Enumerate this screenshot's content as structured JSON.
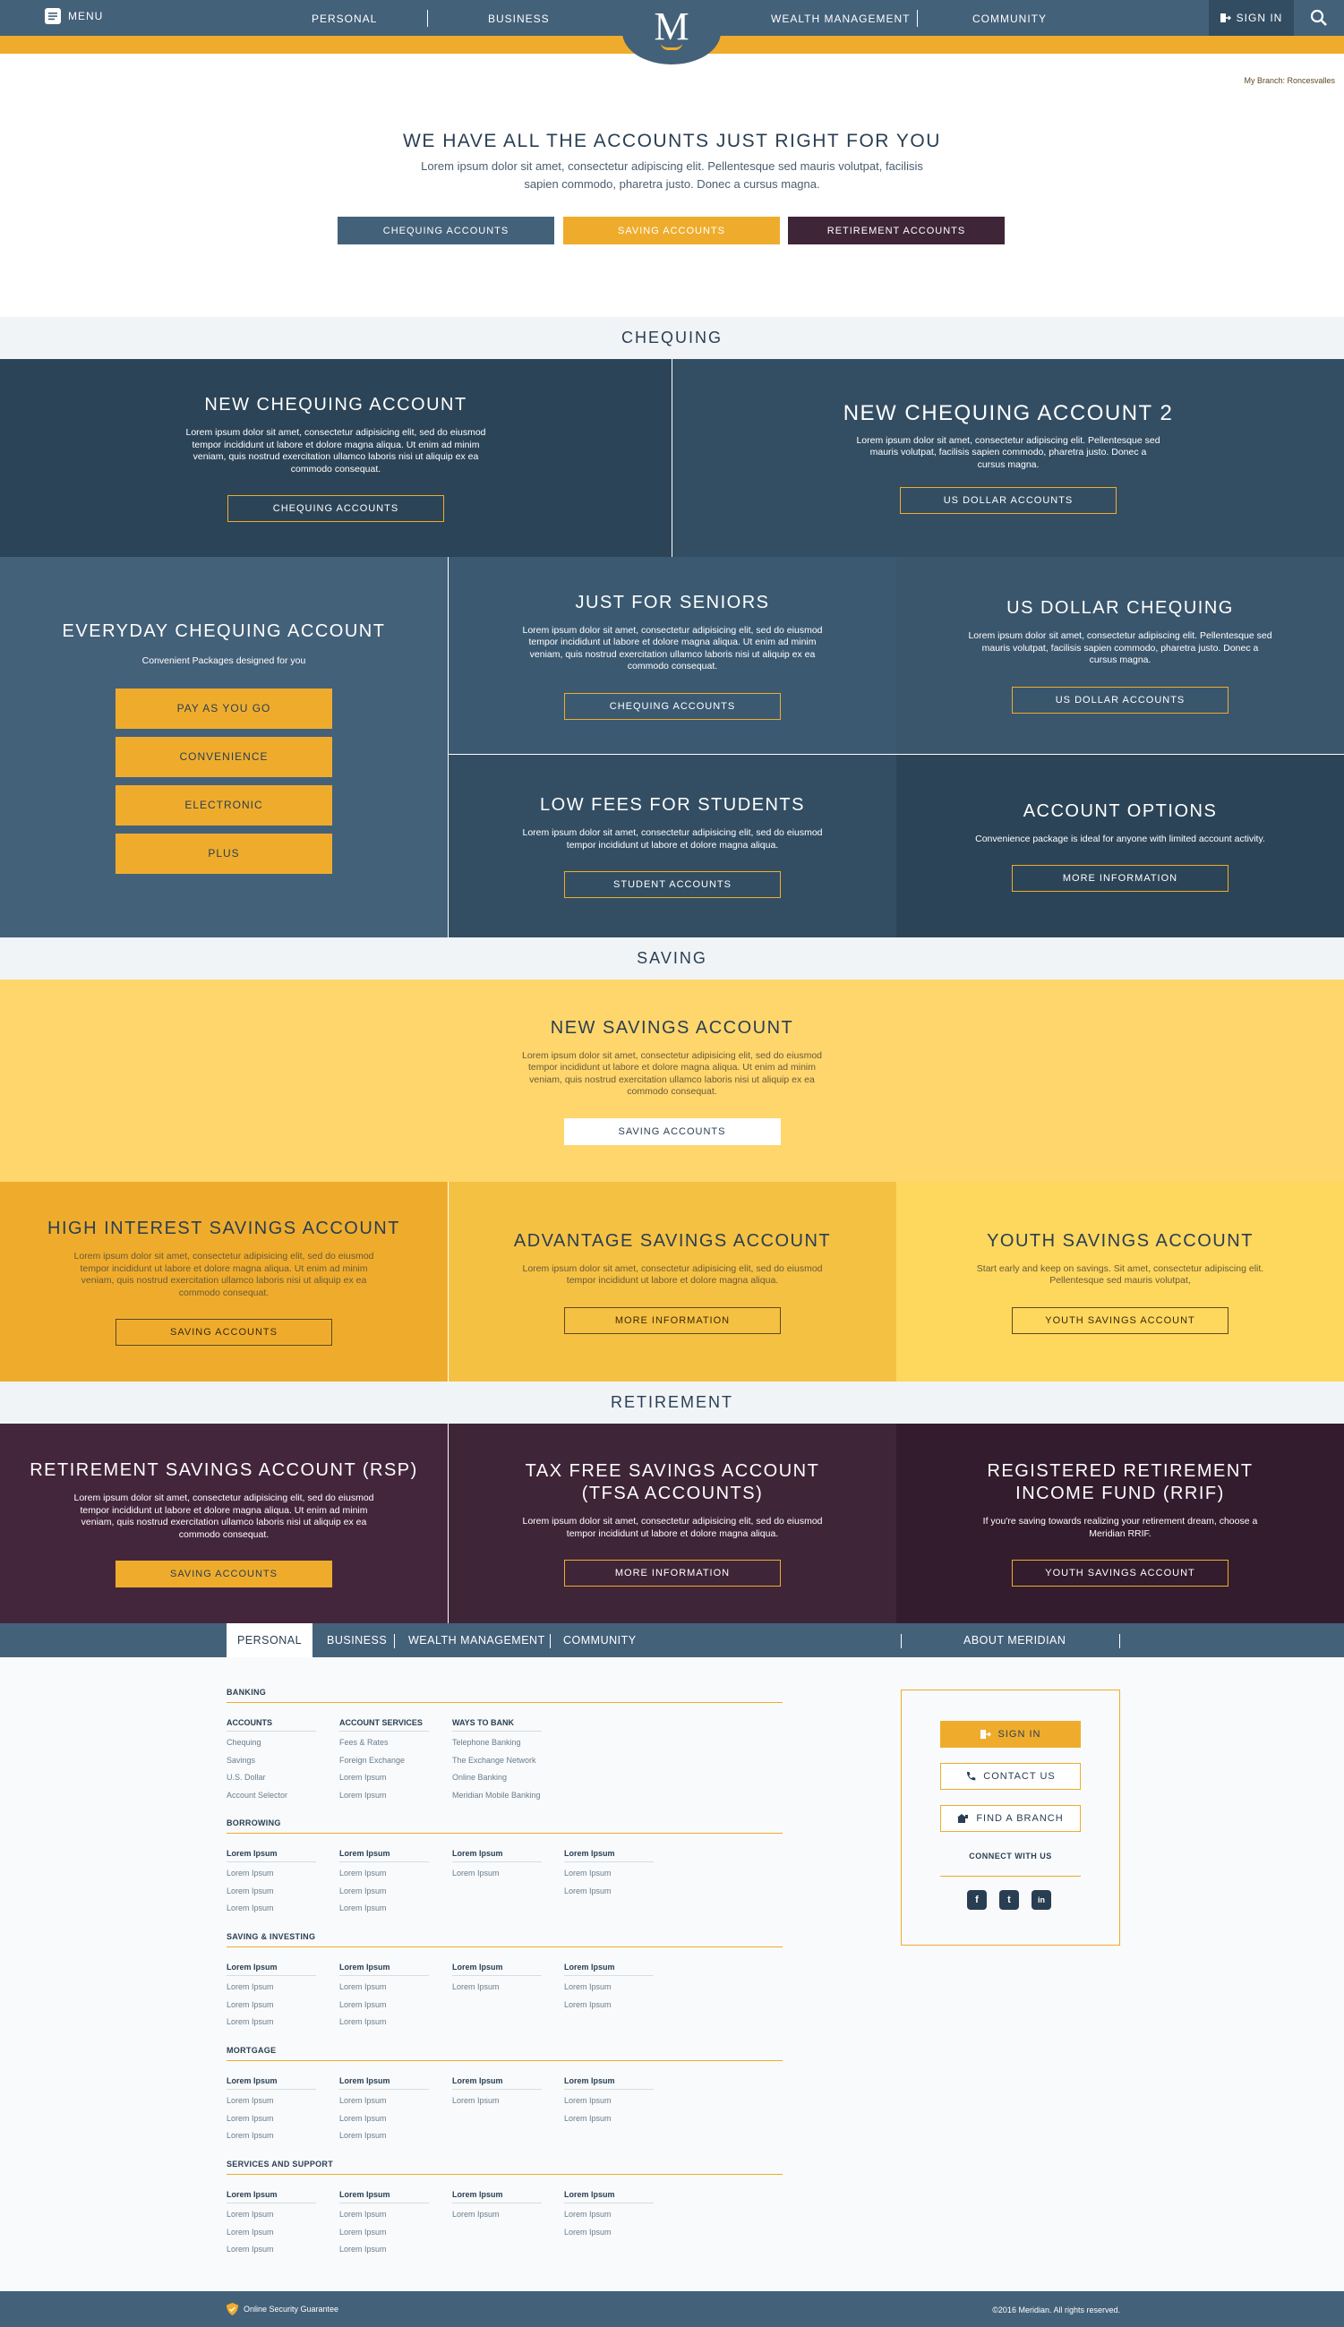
{
  "header": {
    "menu_label": "MENU",
    "nav": [
      "PERSONAL",
      "BUSINESS",
      "WEALTH MANAGEMENT",
      "COMMUNITY"
    ],
    "logo_letter": "M",
    "signin_label": "SIGN IN",
    "branch_text": "My Branch: Roncesvalles"
  },
  "hero": {
    "title": "WE HAVE ALL THE ACCOUNTS JUST RIGHT FOR YOU",
    "text": "Lorem ipsum dolor sit amet, consectetur adipiscing elit. Pellentesque sed mauris volutpat, facilisis sapien commodo, pharetra justo. Donec a cursus magna.",
    "buttons": [
      "CHEQUING ACCOUNTS",
      "SAVING ACCOUNTS",
      "RETIREMENT ACCOUNTS"
    ]
  },
  "sections": {
    "chequing": "CHEQUING",
    "saving": "SAVING",
    "retirement": "RETIREMENT"
  },
  "chequing": {
    "new": {
      "title": "NEW CHEQUING ACCOUNT",
      "text": "Lorem ipsum dolor sit amet, consectetur adipisicing elit, sed do eiusmod tempor incididunt ut labore et dolore magna aliqua. Ut enim ad minim veniam, quis nostrud exercitation ullamco laboris nisi ut aliquip ex ea commodo consequat.",
      "button": "CHEQUING ACCOUNTS"
    },
    "new2": {
      "title": "NEW CHEQUING ACCOUNT 2",
      "text": "Lorem ipsum dolor sit amet, consectetur adipiscing elit. Pellentesque sed mauris volutpat, facilisis sapien commodo, pharetra justo. Donec a cursus magna.",
      "button": "US DOLLAR ACCOUNTS"
    },
    "everyday": {
      "title": "EVERYDAY CHEQUING ACCOUNT",
      "subtitle": "Convenient Packages designed for you",
      "buttons": [
        "PAY AS YOU GO",
        "CONVENIENCE",
        "ELECTRONIC",
        "PLUS"
      ]
    },
    "seniors": {
      "title": "JUST FOR SENIORS",
      "text": "Lorem ipsum dolor sit amet, consectetur adipisicing elit, sed do eiusmod tempor incididunt ut labore et dolore magna aliqua. Ut enim ad minim veniam, quis nostrud exercitation ullamco laboris nisi ut aliquip ex ea commodo consequat.",
      "button": "CHEQUING ACCOUNTS"
    },
    "usd": {
      "title": "US DOLLAR CHEQUING",
      "text": "Lorem ipsum dolor sit amet, consectetur adipiscing elit. Pellentesque sed mauris volutpat, facilisis sapien commodo, pharetra justo. Donec a cursus magna.",
      "button": "US DOLLAR ACCOUNTS"
    },
    "students": {
      "title": "LOW FEES FOR STUDENTS",
      "text": "Lorem ipsum dolor sit amet, consectetur adipisicing elit, sed do eiusmod tempor incididunt ut labore et dolore magna aliqua.",
      "button": "STUDENT ACCOUNTS"
    },
    "options": {
      "title": "ACCOUNT OPTIONS",
      "text": "Convenience package is ideal for anyone with limited account activity.",
      "button": "MORE INFORMATION"
    }
  },
  "saving": {
    "new": {
      "title": "NEW SAVINGS ACCOUNT",
      "text": "Lorem ipsum dolor sit amet, consectetur adipisicing elit, sed do eiusmod tempor incididunt ut labore et dolore magna aliqua. Ut enim ad minim veniam, quis nostrud exercitation ullamco laboris nisi ut aliquip ex ea commodo consequat.",
      "button": "SAVING ACCOUNTS"
    },
    "high": {
      "title": "HIGH INTEREST SAVINGS ACCOUNT",
      "text": "Lorem ipsum dolor sit amet, consectetur adipisicing elit, sed do eiusmod tempor incididunt ut labore et dolore magna aliqua. Ut enim ad minim veniam, quis nostrud exercitation ullamco laboris nisi ut aliquip ex ea commodo consequat.",
      "button": "SAVING ACCOUNTS"
    },
    "advantage": {
      "title": "ADVANTAGE SAVINGS ACCOUNT",
      "text": "Lorem ipsum dolor sit amet, consectetur adipisicing elit, sed do eiusmod tempor incididunt ut labore et dolore magna aliqua.",
      "button": "MORE INFORMATION"
    },
    "youth": {
      "title": "YOUTH SAVINGS ACCOUNT",
      "text": "Start early and keep on savings. Sit amet, consectetur adipiscing elit. Pellentesque sed mauris volutpat,",
      "button": "YOUTH SAVINGS ACCOUNT"
    }
  },
  "retirement": {
    "rsp": {
      "title": "RETIREMENT SAVINGS ACCOUNT (RSP)",
      "text": "Lorem ipsum dolor sit amet, consectetur adipisicing elit, sed do eiusmod tempor incididunt ut labore et dolore magna aliqua. Ut enim ad minim veniam, quis nostrud exercitation ullamco laboris nisi ut aliquip ex ea commodo consequat.",
      "button": "SAVING ACCOUNTS"
    },
    "tfsa": {
      "title": "TAX FREE SAVINGS ACCOUNT (TFSA ACCOUNTS)",
      "text": "Lorem ipsum dolor sit amet, consectetur adipisicing elit, sed do eiusmod tempor incididunt ut labore et dolore magna aliqua.",
      "button": "MORE INFORMATION"
    },
    "rrif": {
      "title": "REGISTERED RETIREMENT INCOME FUND (RRIF)",
      "text": "If you're saving towards realizing your retirement dream, choose a Meridian RRIF.",
      "button": "YOUTH SAVINGS ACCOUNT"
    }
  },
  "footer": {
    "nav": [
      "PERSONAL",
      "BUSINESS",
      "WEALTH MANAGEMENT",
      "COMMUNITY",
      "ABOUT MERIDIAN"
    ],
    "banking": {
      "title": "BANKING",
      "cols": [
        {
          "head": "ACCOUNTS",
          "items": [
            "Chequing",
            "Savings",
            "U.S. Dollar",
            "Account Selector"
          ]
        },
        {
          "head": "ACCOUNT SERVICES",
          "items": [
            "Fees & Rates",
            "Foreign Exchange",
            "Lorem Ipsum",
            "Lorem Ipsum"
          ]
        },
        {
          "head": "WAYS TO BANK",
          "items": [
            "Telephone Banking",
            "The Exchange Network",
            "Online Banking",
            "Meridian Mobile Banking"
          ]
        }
      ]
    },
    "groups": [
      {
        "title": "BORROWING"
      },
      {
        "title": "SAVING & INVESTING"
      },
      {
        "title": "MORTGAGE"
      },
      {
        "title": "SERVICES AND SUPPORT"
      }
    ],
    "generic_cols": [
      {
        "head": "Lorem Ipsum",
        "items": [
          "Lorem Ipsum",
          "Lorem Ipsum",
          "Lorem Ipsum"
        ]
      },
      {
        "head": "Lorem Ipsum",
        "items": [
          "Lorem Ipsum",
          "Lorem Ipsum",
          "Lorem Ipsum"
        ]
      },
      {
        "head": "Lorem Ipsum",
        "items": [
          "Lorem Ipsum"
        ]
      },
      {
        "head": "Lorem Ipsum",
        "items": [
          "Lorem Ipsum",
          "Lorem Ipsum"
        ]
      }
    ],
    "box": {
      "signin": "SIGN IN",
      "contact": "CONTACT US",
      "branch": "FIND A BRANCH",
      "connect": "CONNECT WITH US",
      "social": [
        "f",
        "t",
        "in"
      ]
    },
    "security": "Online Security Guarantee",
    "copyright": "©2016 Meridian. All rights reserved."
  },
  "colors": {
    "slate": "#44617a",
    "navy": "#2f4a5f",
    "gold": "#efac2c",
    "plum": "#3f2538",
    "yellow_light": "#fed66c"
  }
}
